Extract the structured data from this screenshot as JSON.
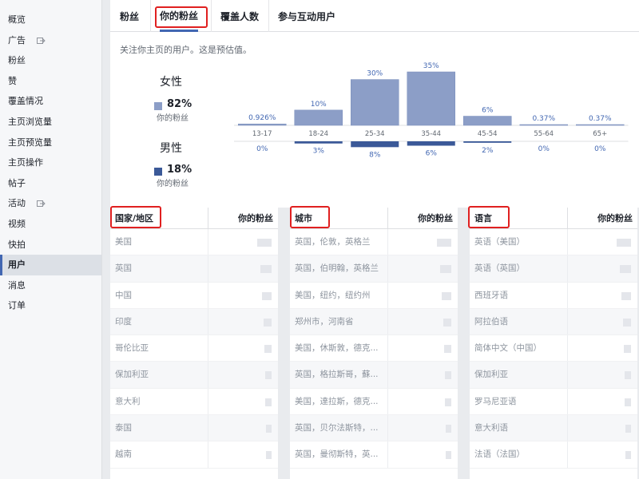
{
  "sidebar": {
    "items": [
      {
        "label": "概览"
      },
      {
        "label": "广告",
        "ext": true
      },
      {
        "label": "粉丝"
      },
      {
        "label": "赞"
      },
      {
        "label": "覆盖情况"
      },
      {
        "label": "主页浏览量"
      },
      {
        "label": "主页预览量"
      },
      {
        "label": "主页操作"
      },
      {
        "label": "帖子"
      },
      {
        "label": "活动",
        "ext": true
      },
      {
        "label": "视频"
      },
      {
        "label": "快拍"
      },
      {
        "label": "用户",
        "active": true
      },
      {
        "label": "消息"
      },
      {
        "label": "订单"
      }
    ]
  },
  "tabs": [
    {
      "label": "粉丝"
    },
    {
      "label": "你的粉丝",
      "selected": true
    },
    {
      "label": "覆盖人数"
    },
    {
      "label": "参与互动用户"
    }
  ],
  "demographics": {
    "description": "关注你主页的用户。这是预估值。",
    "female": {
      "label": "女性",
      "percent": "82%",
      "sub": "你的粉丝"
    },
    "male": {
      "label": "男性",
      "percent": "18%",
      "sub": "你的粉丝"
    }
  },
  "chart_data": {
    "type": "bar",
    "categories": [
      "13-17",
      "18-24",
      "25-34",
      "35-44",
      "45-54",
      "55-64",
      "65+"
    ],
    "series": [
      {
        "name": "女性",
        "values": [
          0.926,
          10,
          30,
          35,
          6,
          0.37,
          0.37
        ],
        "labels": [
          "0.926%",
          "10%",
          "30%",
          "35%",
          "6%",
          "0.37%",
          "0.37%"
        ],
        "color": "#8c9ec7"
      },
      {
        "name": "男性",
        "values": [
          0,
          3,
          8,
          6,
          2,
          0,
          0
        ],
        "labels": [
          "0%",
          "3%",
          "8%",
          "6%",
          "2%",
          "0%",
          "0%"
        ],
        "color": "#3b5998"
      }
    ]
  },
  "tables": {
    "country": {
      "header_left": "国家/地区",
      "header_right": "你的粉丝",
      "rows": [
        "美国",
        "英国",
        "中国",
        "印度",
        "哥伦比亚",
        "保加利亚",
        "意大利",
        "泰国",
        "越南"
      ]
    },
    "city": {
      "header_left": "城市",
      "header_right": "你的粉丝",
      "rows": [
        "英国，伦敦，英格兰",
        "英国，伯明翰，英格兰",
        "美国，纽约，纽约州",
        "郑州市，河南省",
        "美国，休斯敦，德克...",
        "英国，格拉斯哥，蘇...",
        "美国，達拉斯，德克...",
        "英国，贝尔法斯特，...",
        "英国，曼彻斯特，英..."
      ]
    },
    "language": {
      "header_left": "语言",
      "header_right": "你的粉丝",
      "rows": [
        "英语（美国）",
        "英语（英国）",
        "西班牙语",
        "阿拉伯语",
        "简体中文（中国）",
        "保加利亚",
        "罗马尼亚语",
        "意大利语",
        "法语（法国）"
      ]
    }
  },
  "colors": {
    "accent": "#4267b2",
    "highlight_box": "#e02020"
  }
}
